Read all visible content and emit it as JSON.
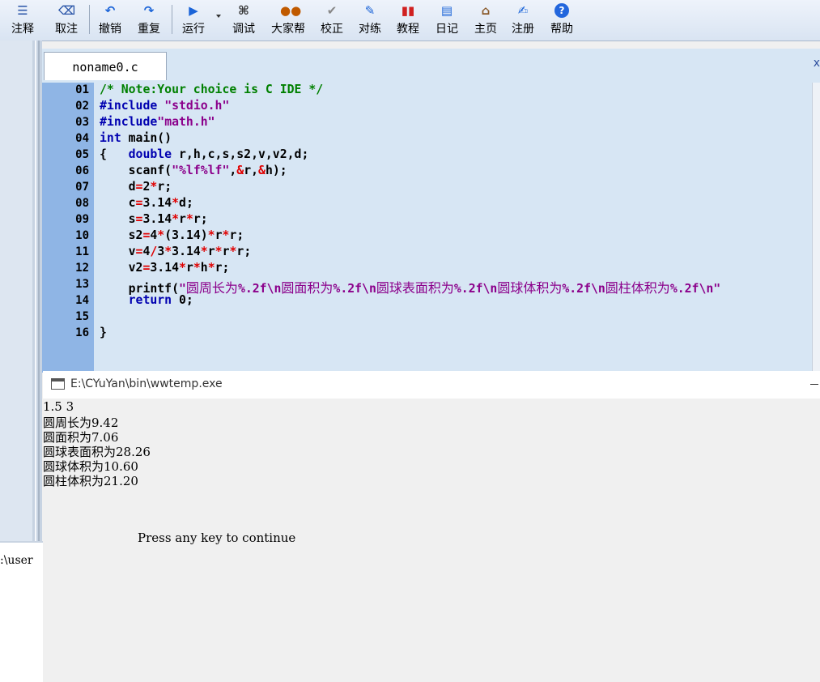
{
  "toolbar": {
    "buttons": [
      {
        "label": "注释",
        "icon": "comment-icon"
      },
      {
        "label": "取注",
        "icon": "uncomment-icon"
      },
      {
        "label": "撤销",
        "icon": "undo-icon"
      },
      {
        "label": "重复",
        "icon": "redo-icon"
      },
      {
        "label": "运行",
        "icon": "run-icon"
      },
      {
        "label": "调试",
        "icon": "debug-icon"
      },
      {
        "label": "大家帮",
        "icon": "community-icon"
      },
      {
        "label": "校正",
        "icon": "check-icon"
      },
      {
        "label": "对练",
        "icon": "practice-icon"
      },
      {
        "label": "教程",
        "icon": "tutorial-icon"
      },
      {
        "label": "日记",
        "icon": "diary-icon"
      },
      {
        "label": "主页",
        "icon": "home-icon"
      },
      {
        "label": "注册",
        "icon": "register-icon"
      },
      {
        "label": "帮助",
        "icon": "help-icon"
      }
    ]
  },
  "editor": {
    "tab_label": "noname0.c",
    "close_glyph": "x",
    "line_numbers": [
      "01",
      "02",
      "03",
      "04",
      "05",
      "06",
      "07",
      "08",
      "09",
      "10",
      "11",
      "12",
      "13",
      "14",
      "15",
      "16"
    ]
  },
  "console": {
    "title": "E:\\CYuYan\\bin\\wwtemp.exe",
    "lines": [
      "1.5 3",
      "圆周长为9.42",
      "圆面积为7.06",
      "圆球表面积为28.26",
      "圆球体积为10.60",
      "圆柱体积为21.20"
    ],
    "prompt": "Press any key to continue"
  },
  "left_panel": {
    "bottom_text": ":\\user"
  },
  "colors": {
    "gutter": "#8fb5e5",
    "editor_bg": "#d7e6f4",
    "keyword": "#0000b0",
    "comment": "#008000",
    "string": "#8b008b",
    "operator": "#e00000"
  }
}
